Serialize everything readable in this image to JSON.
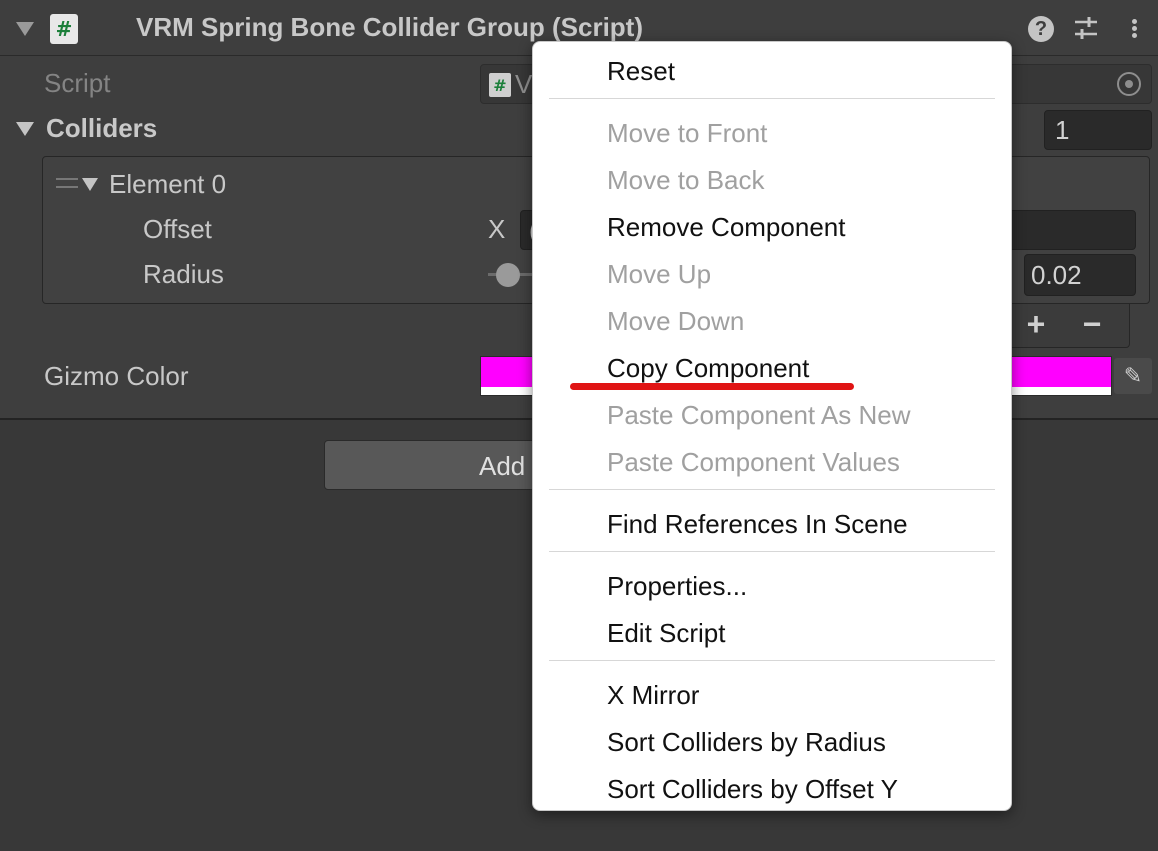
{
  "component": {
    "title": "VRM Spring Bone Collider Group (Script)",
    "script_icon_glyph": "#",
    "help_glyph": "?",
    "presets_glyph": "⚙",
    "settings_glyph": "⋮"
  },
  "fields": {
    "script_label": "Script",
    "script_value": "V",
    "colliders_label": "Colliders",
    "colliders_size": "1",
    "element_label": "Element 0",
    "offset_label": "Offset",
    "offset_x_label": "X",
    "offset_x_value": "(",
    "radius_label": "Radius",
    "radius_value": "0.02",
    "list_add_glyph": "+",
    "list_remove_glyph": "−",
    "gizmo_color_label": "Gizmo Color",
    "gizmo_color": "#ff00ff",
    "eyedropper_glyph": "✎"
  },
  "add_component_label": "Add",
  "context_menu": {
    "items": [
      {
        "label": "Reset",
        "enabled": true
      },
      {
        "label": "Move to Front",
        "enabled": false
      },
      {
        "label": "Move to Back",
        "enabled": false
      },
      {
        "label": "Remove Component",
        "enabled": true
      },
      {
        "label": "Move Up",
        "enabled": false
      },
      {
        "label": "Move Down",
        "enabled": false
      },
      {
        "label": "Copy Component",
        "enabled": true
      },
      {
        "label": "Paste Component As New",
        "enabled": false
      },
      {
        "label": "Paste Component Values",
        "enabled": false
      },
      {
        "label": "Find References In Scene",
        "enabled": true
      },
      {
        "label": "Properties...",
        "enabled": true
      },
      {
        "label": "Edit Script",
        "enabled": true
      },
      {
        "label": "X Mirror",
        "enabled": true
      },
      {
        "label": "Sort Colliders by Radius",
        "enabled": true
      },
      {
        "label": "Sort Colliders by Offset Y",
        "enabled": true
      }
    ],
    "highlight_color": "#e01414"
  }
}
